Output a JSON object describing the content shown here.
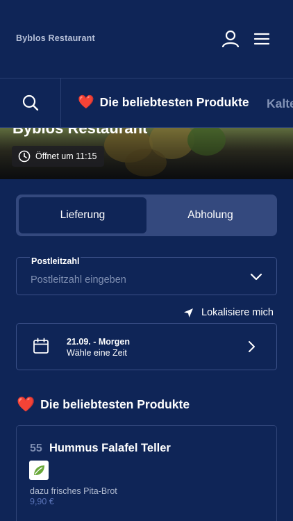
{
  "header": {
    "title": "Byblos Restaurant",
    "user_icon": "user-icon",
    "menu_icon": "hamburger-menu-icon"
  },
  "category_bar": {
    "search_icon": "search-icon",
    "active_category": "Die beliebtesten Produkte",
    "active_emoji": "❤️",
    "next_category": "Kalte"
  },
  "hero": {
    "restaurant_name": "Byblos Restaurant",
    "opening_text": "Öffnet um 11:15"
  },
  "order_type": {
    "options": [
      "Lieferung",
      "Abholung"
    ],
    "selected": "Lieferung"
  },
  "postal_code": {
    "label": "Postleitzahl",
    "placeholder": "Postleitzahl eingeben"
  },
  "locate": {
    "label": "Lokalisiere mich"
  },
  "delivery_time": {
    "date": "21.09. - Morgen",
    "hint": "Wähle eine Zeit"
  },
  "popular_section": {
    "emoji": "❤️",
    "title": "Die beliebtesten Produkte"
  },
  "products": [
    {
      "number": "55",
      "name": "Hummus Falafel Teller",
      "description": "dazu frisches Pita-Brot",
      "price": "9,90 €",
      "badge_icon": "vegan-leaf-icon"
    }
  ],
  "colors": {
    "background": "#0f2557",
    "toggle_track": "#34497e",
    "border": "#3b5088",
    "heart": "#e8373f",
    "price": "#5a73b8"
  }
}
